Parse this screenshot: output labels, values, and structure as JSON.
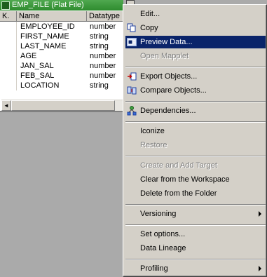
{
  "source_window": {
    "title": "EMP_FILE (Flat File)",
    "columns": [
      "K.",
      "Name",
      "Datatype"
    ],
    "rows": [
      {
        "name": "EMPLOYEE_ID",
        "type": "number"
      },
      {
        "name": "FIRST_NAME",
        "type": "string"
      },
      {
        "name": "LAST_NAME",
        "type": "string"
      },
      {
        "name": "AGE",
        "type": "number"
      },
      {
        "name": "JAN_SAL",
        "type": "number"
      },
      {
        "name": "FEB_SAL",
        "type": "number"
      },
      {
        "name": "LOCATION",
        "type": "string"
      }
    ],
    "scroll_left_glyph": "◄"
  },
  "menu": {
    "items": [
      {
        "label": "Edit..."
      },
      {
        "label": "Copy",
        "icon": "copy-icon"
      },
      {
        "label": "Preview Data...",
        "icon": "preview-data-icon",
        "highlighted": true
      },
      {
        "label": "Open Mapplet",
        "disabled": true
      },
      {
        "label": "Export Objects...",
        "icon": "export-icon"
      },
      {
        "label": "Compare Objects...",
        "icon": "compare-icon"
      },
      {
        "label": "Dependencies...",
        "icon": "dependencies-icon"
      },
      {
        "label": "Iconize"
      },
      {
        "label": "Restore",
        "disabled": true
      },
      {
        "label": "Create and Add Target",
        "disabled": true
      },
      {
        "label": "Clear from the Workspace"
      },
      {
        "label": "Delete from the Folder"
      },
      {
        "label": "Versioning",
        "submenu": true
      },
      {
        "label": "Set options..."
      },
      {
        "label": "Data Lineage"
      },
      {
        "label": "Profiling",
        "submenu": true
      }
    ]
  },
  "colors": {
    "highlight": "#0a246a",
    "title_bar": "#2e8b2e",
    "menu_bg": "#d4d0c8"
  }
}
